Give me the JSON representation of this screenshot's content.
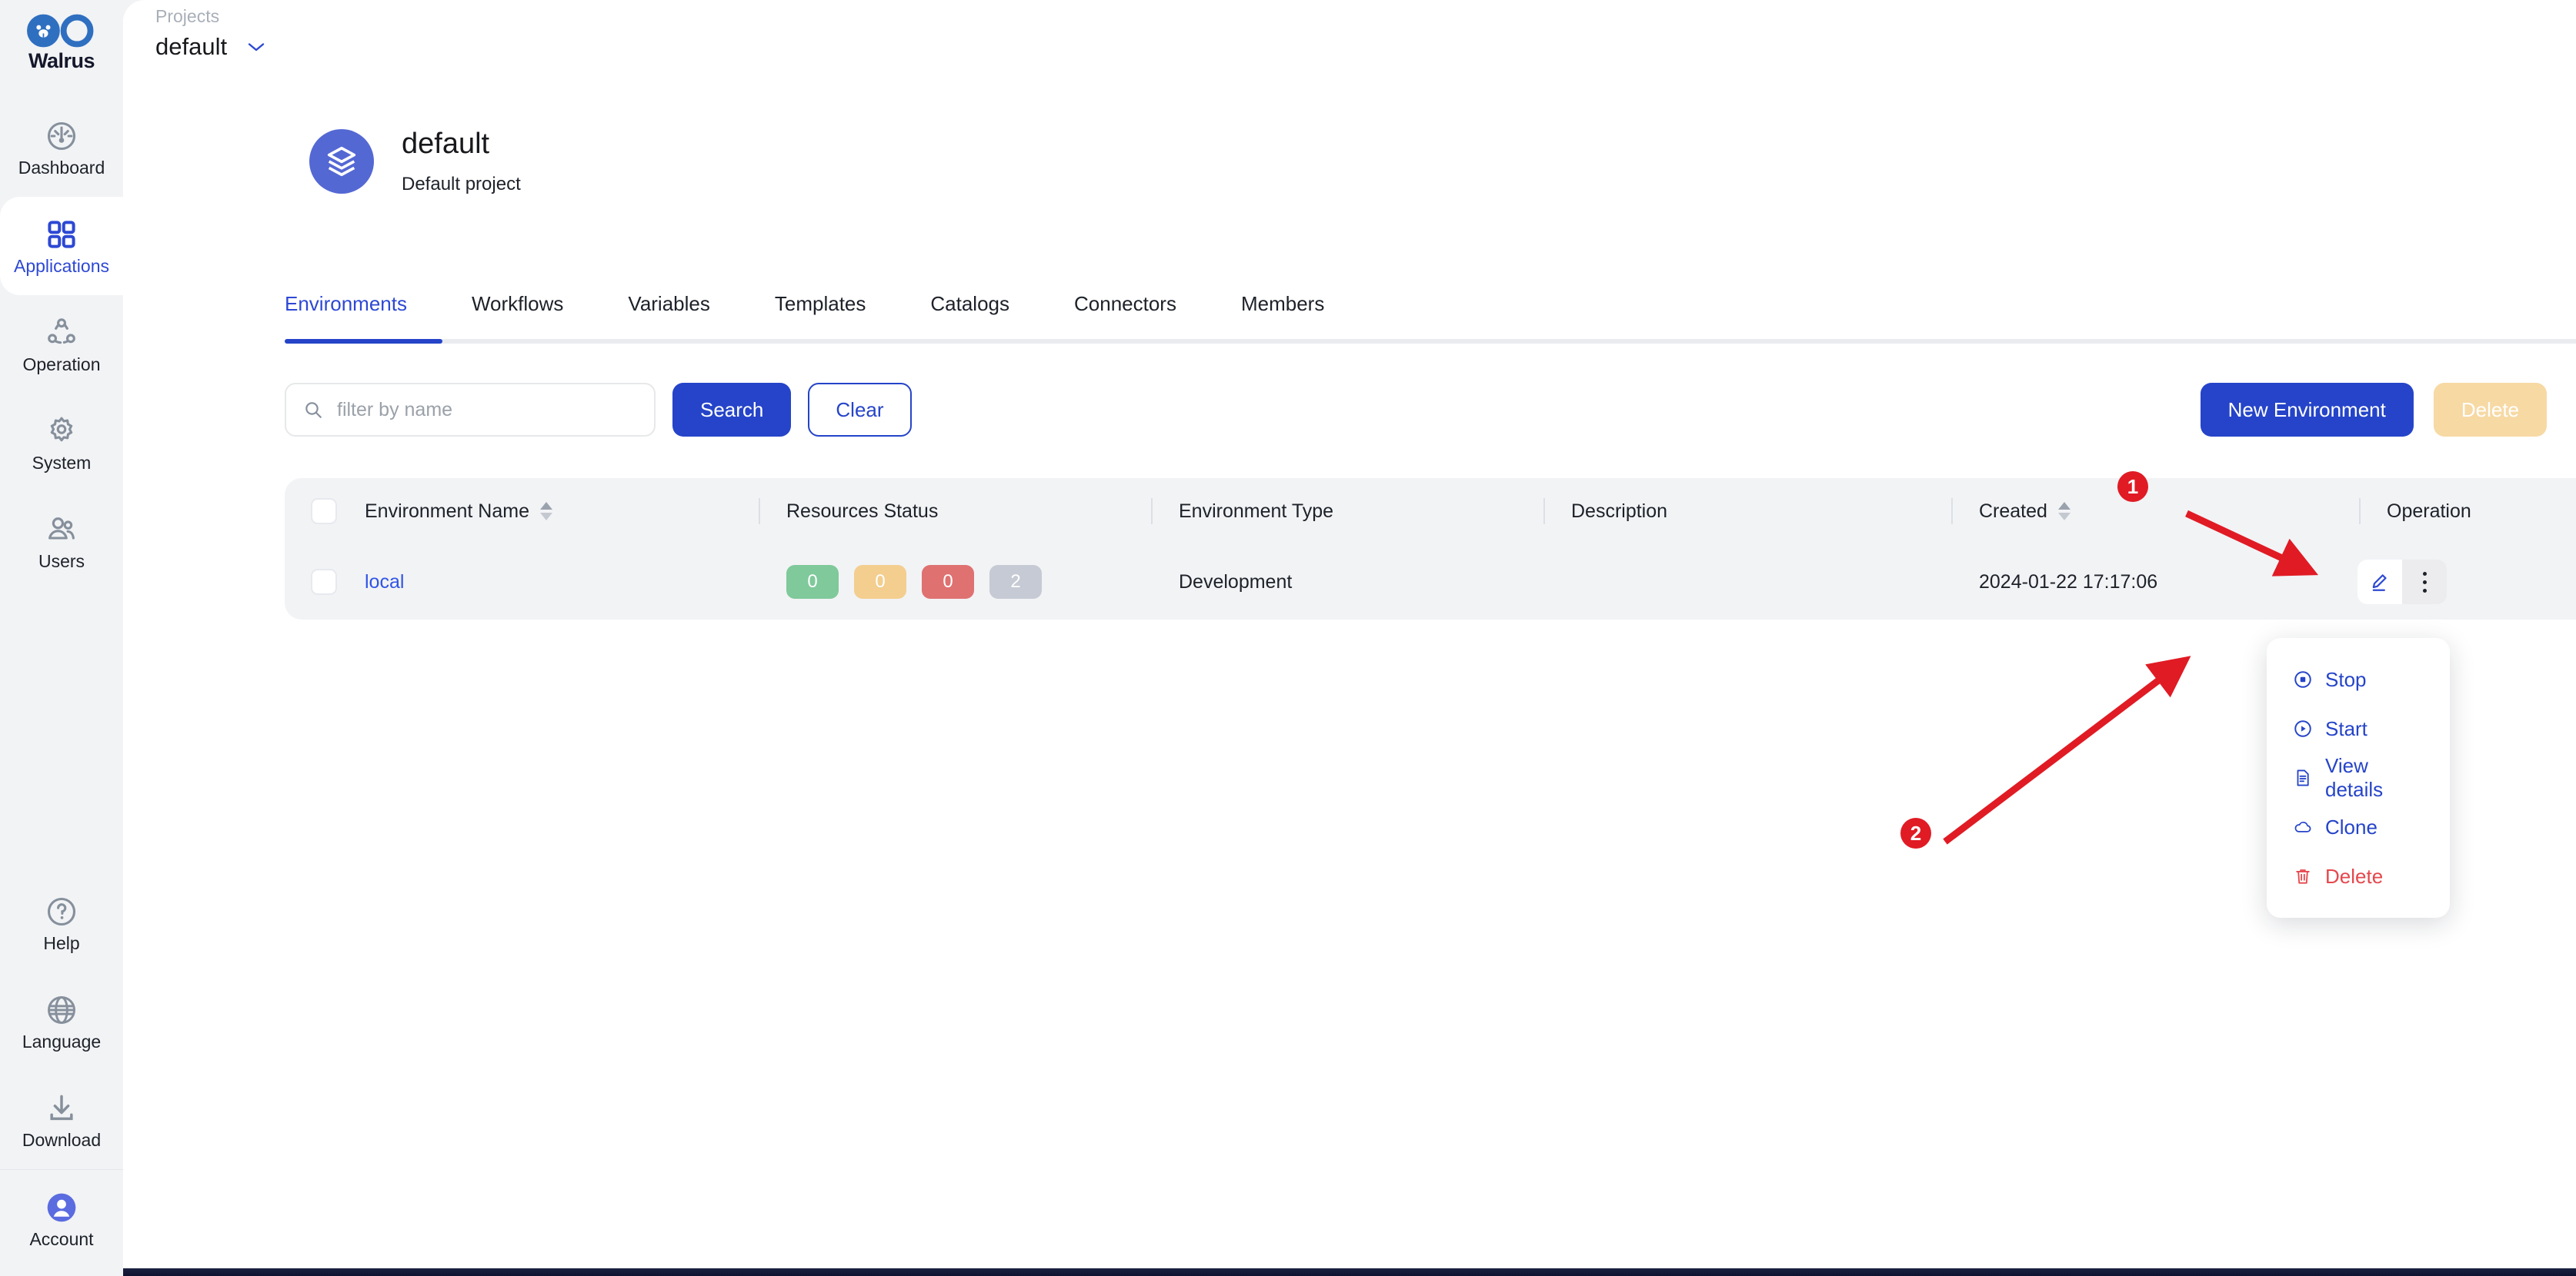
{
  "app": {
    "brand_name": "Walrus"
  },
  "sidebar": {
    "items": [
      {
        "label": "Dashboard",
        "icon": "dashboard-icon",
        "active": false
      },
      {
        "label": "Applications",
        "icon": "applications-icon",
        "active": true
      },
      {
        "label": "Operation",
        "icon": "operation-icon",
        "active": false
      },
      {
        "label": "System",
        "icon": "gear-icon",
        "active": false
      },
      {
        "label": "Users",
        "icon": "users-icon",
        "active": false
      }
    ],
    "bottom_items": [
      {
        "label": "Help",
        "icon": "question-circle-icon"
      },
      {
        "label": "Language",
        "icon": "globe-icon"
      },
      {
        "label": "Download",
        "icon": "download-icon"
      },
      {
        "label": "Account",
        "icon": "account-avatar-icon"
      }
    ]
  },
  "topbar": {
    "crumb_label": "Projects",
    "crumb_value": "default",
    "chevron_icon": "chevron-down-icon"
  },
  "project": {
    "avatar_icon": "layers-icon",
    "title": "default",
    "subtitle": "Default project"
  },
  "tabs": [
    {
      "label": "Environments",
      "active": true
    },
    {
      "label": "Workflows",
      "active": false
    },
    {
      "label": "Variables",
      "active": false
    },
    {
      "label": "Templates",
      "active": false
    },
    {
      "label": "Catalogs",
      "active": false
    },
    {
      "label": "Connectors",
      "active": false
    },
    {
      "label": "Members",
      "active": false
    }
  ],
  "toolbar": {
    "search_placeholder": "filter by name",
    "search_value": "",
    "search_icon": "search-icon",
    "search_label": "Search",
    "clear_label": "Clear",
    "new_environment_label": "New Environment",
    "delete_label": "Delete"
  },
  "table": {
    "columns": [
      {
        "key": "name",
        "label": "Environment Name",
        "sortable": true
      },
      {
        "key": "resources",
        "label": "Resources Status",
        "sortable": false
      },
      {
        "key": "type",
        "label": "Environment Type",
        "sortable": false
      },
      {
        "key": "description",
        "label": "Description",
        "sortable": false
      },
      {
        "key": "created",
        "label": "Created",
        "sortable": true
      },
      {
        "key": "operation",
        "label": "Operation",
        "sortable": false
      }
    ],
    "rows": [
      {
        "name": "local",
        "resources": [
          {
            "value": "0",
            "color": "#7fc99a"
          },
          {
            "value": "0",
            "color": "#f3ce8f"
          },
          {
            "value": "0",
            "color": "#df7171"
          },
          {
            "value": "2",
            "color": "#c6cad4"
          }
        ],
        "type": "Development",
        "description": "",
        "created": "2024-01-22 17:17:06",
        "edit_icon": "pencil-icon",
        "more_icon": "more-vertical-icon"
      }
    ]
  },
  "context_menu": {
    "items": [
      {
        "label": "Stop",
        "icon": "stop-circle-icon",
        "danger": false
      },
      {
        "label": "Start",
        "icon": "play-circle-icon",
        "danger": false
      },
      {
        "label": "View details",
        "icon": "document-icon",
        "danger": false
      },
      {
        "label": "Clone",
        "icon": "cloud-icon",
        "danger": false
      },
      {
        "label": "Delete",
        "icon": "trash-icon",
        "danger": true
      }
    ]
  },
  "annotations": [
    {
      "number": "1"
    },
    {
      "number": "2"
    }
  ],
  "colors": {
    "accent": "#2544c9",
    "link": "#3054e6",
    "danger": "#e5484d",
    "annotation": "#e01b24",
    "panel_bg": "#f2f3f5"
  }
}
